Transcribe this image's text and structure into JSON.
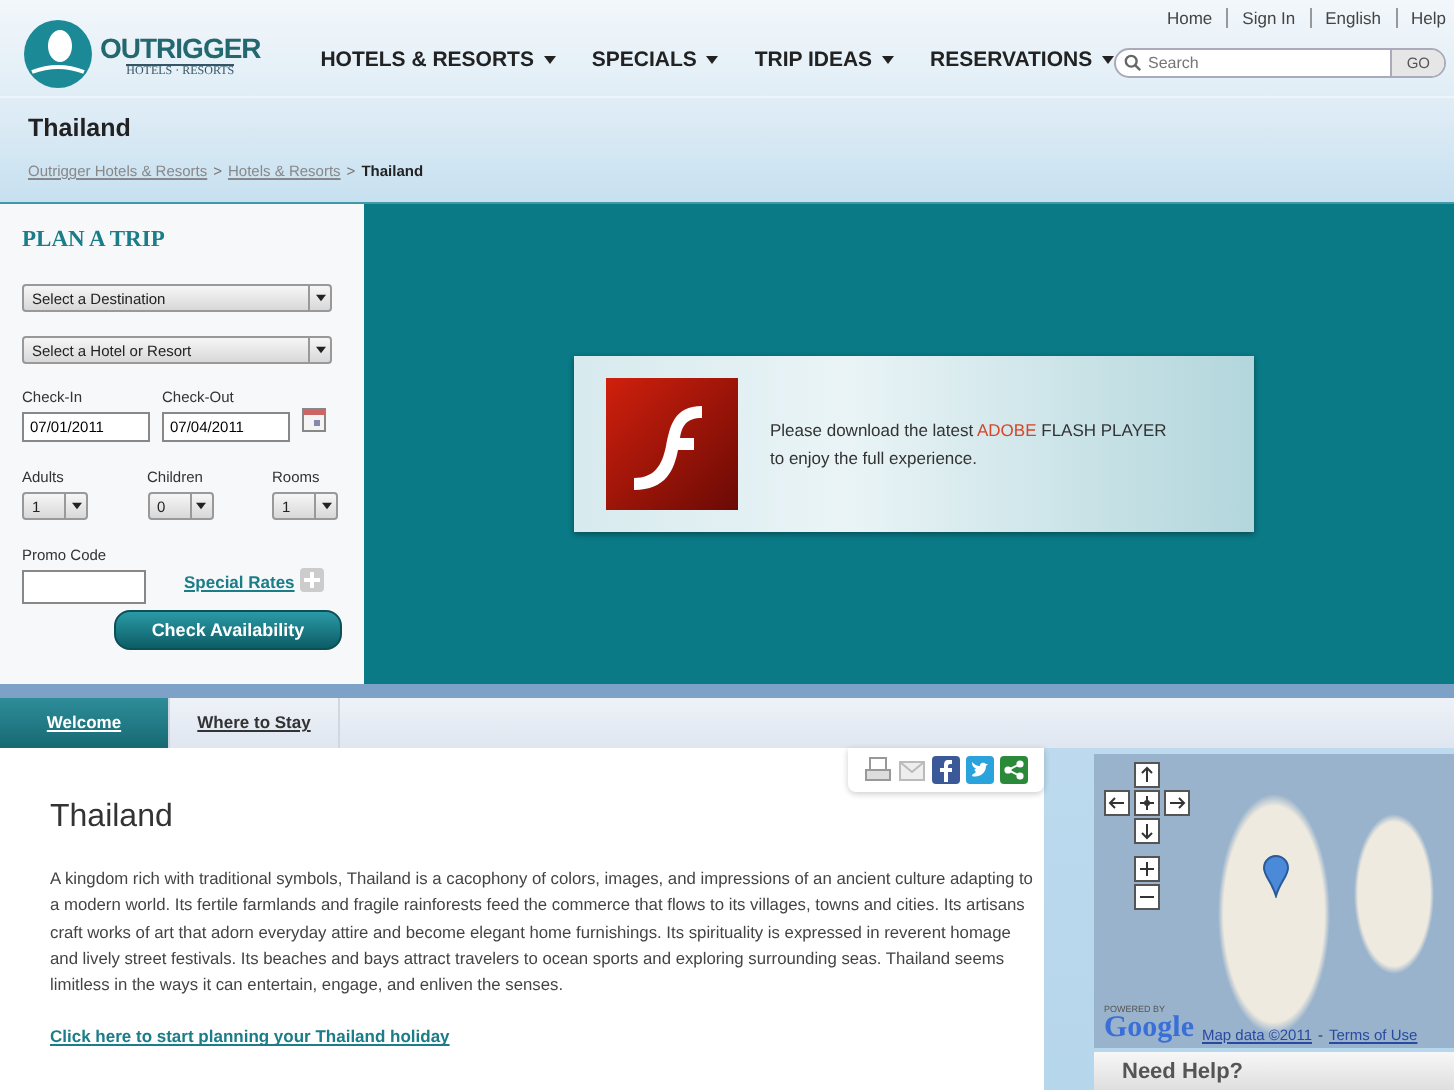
{
  "header": {
    "logo": {
      "name": "OUTRIGGER",
      "tagline": "HOTELS · RESORTS"
    },
    "utility_links": [
      "Home",
      "Sign In",
      "English",
      "Help"
    ],
    "nav": [
      "HOTELS & RESORTS",
      "SPECIALS",
      "TRIP IDEAS",
      "RESERVATIONS"
    ],
    "search": {
      "placeholder": "Search",
      "button": "GO"
    }
  },
  "page_title": "Thailand",
  "breadcrumb": {
    "separator": ">",
    "items": [
      {
        "label": "Outrigger Hotels & Resorts",
        "kind": "link"
      },
      {
        "label": "Hotels & Resorts",
        "kind": "link"
      },
      {
        "label": "Thailand",
        "kind": "current"
      }
    ]
  },
  "plan_trip": {
    "title": "PLAN A TRIP",
    "destination": "Select a Destination",
    "hotel": "Select a Hotel or Resort",
    "check_in": {
      "label": "Check-In",
      "value": "07/01/2011"
    },
    "check_out": {
      "label": "Check-Out",
      "value": "07/04/2011"
    },
    "guests": [
      {
        "label": "Adults",
        "value": "1"
      },
      {
        "label": "Children",
        "value": "0"
      },
      {
        "label": "Rooms",
        "value": "1"
      }
    ],
    "promo_label": "Promo Code",
    "special_rates": "Special Rates",
    "button": "Check Availability"
  },
  "flash": {
    "before": "Please download the latest",
    "highlight": "ADOBE",
    "after": "FLASH PLAYER",
    "line2": "to enjoy the full experience."
  },
  "tabs": [
    {
      "label": "Welcome",
      "selected": true
    },
    {
      "label": "Where to Stay",
      "selected": false
    }
  ],
  "article": {
    "title": "Thailand",
    "body": "A kingdom rich with traditional symbols, Thailand is a cacophony of colors, images, and impressions of an ancient culture adapting to a modern world.  Its fertile farmlands and fragile rainforests feed the commerce that flows to its villages, towns and cities.  Its artisans craft works of art that adorn everyday attire and become elegant home furnishings.  Its spirituality is expressed in reverent homage and lively street festivals. Its beaches and bays attract travelers to ocean sports and exploring surrounding seas.  Thailand seems limitless in the ways it can entertain, engage, and enliven the senses.",
    "link": "Click here to start planning your Thailand holiday"
  },
  "map": {
    "powered_by": "POWERED BY",
    "brand": "Google",
    "attribution": "Map data ©2011",
    "separator": "-",
    "terms": "Terms of Use"
  },
  "need_help": "Need Help?"
}
